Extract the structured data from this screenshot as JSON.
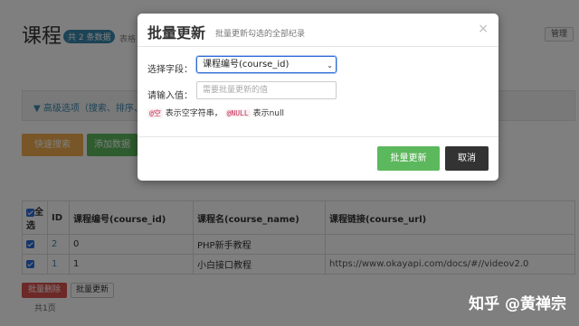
{
  "page": {
    "title": "课程",
    "count_badge": "共 2 条数据",
    "desc": "表格",
    "manage_btn": "管理",
    "adv_search": "高级选项（搜索、排序、",
    "quick_search_btn": "快速搜索",
    "add_btn": "添加数据",
    "table": {
      "headers": [
        "全选",
        "ID",
        "课程编号(course_id)",
        "课程名(course_name)",
        "课程链接(course_url)"
      ],
      "rows": [
        {
          "id": "2",
          "course_id": "0",
          "course_name": "PHP新手教程",
          "course_url": ""
        },
        {
          "id": "1",
          "course_id": "1",
          "course_name": "小白接口教程",
          "course_url": "https://www.okayapi.com/docs/#//videov2.0"
        }
      ]
    },
    "batch_delete_btn": "批量删除",
    "batch_update_btn": "批量更新",
    "pagination": "共1页"
  },
  "modal": {
    "title": "批量更新",
    "subtitle": "批量更新勾选的全部纪录",
    "close": "×",
    "field_label": "选择字段：",
    "field_selected": "课程编号(course_id)",
    "value_label": "请输入值：",
    "value_placeholder": "需要批量更新的值",
    "hint_empty_code": "@空",
    "hint_empty_text": "表示空字符串，",
    "hint_null_code": "@NULL",
    "hint_null_text": "表示null",
    "submit_btn": "批量更新",
    "cancel_btn": "取消"
  },
  "watermark": "知乎 @黄禅宗",
  "colors": {
    "primary": "#5cb85c",
    "danger": "#d9534f",
    "warning": "#f0ad4e",
    "accent": "#3a87ad"
  }
}
